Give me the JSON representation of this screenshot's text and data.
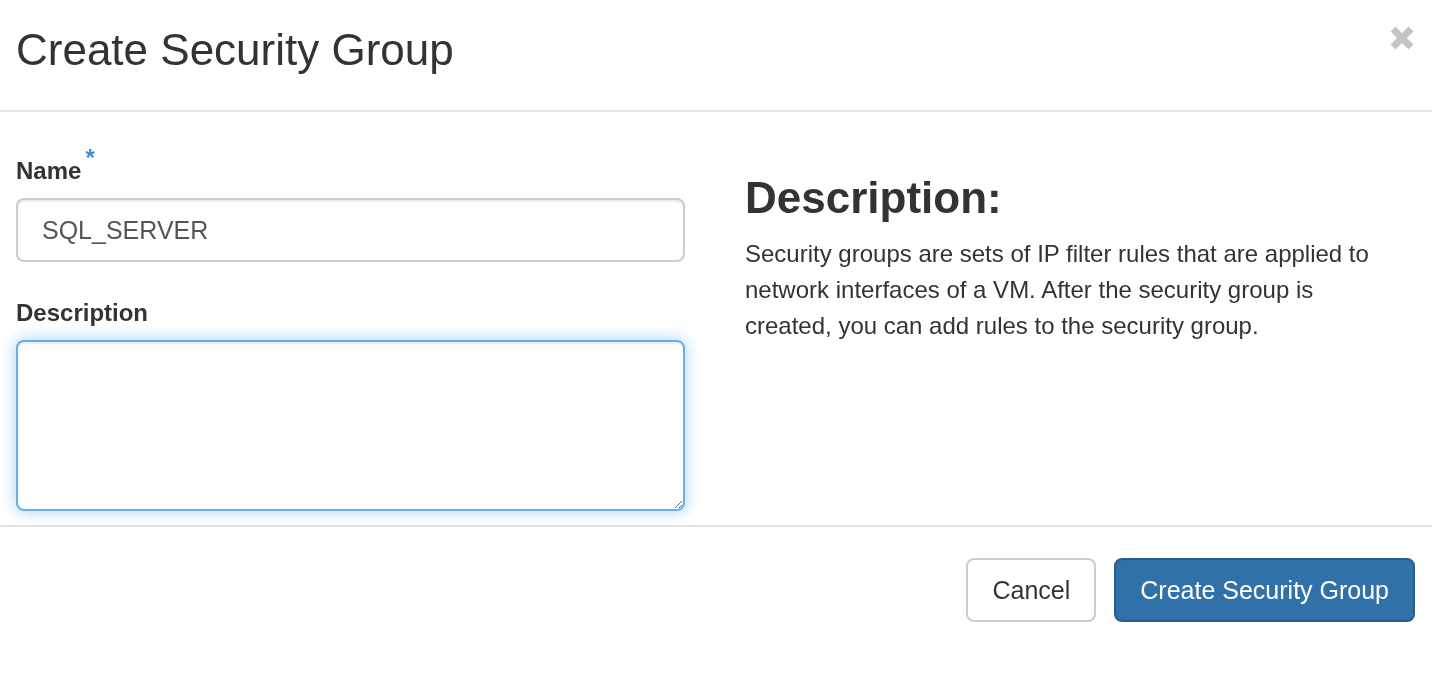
{
  "dialog": {
    "title": "Create Security Group"
  },
  "fields": [
    {
      "kind": "input",
      "label": "Name",
      "required_mark": "*",
      "value": "SQL_SERVER",
      "focused": false
    },
    {
      "kind": "textarea",
      "label": "Description",
      "focused": true
    }
  ],
  "help": {
    "heading": "Description:",
    "text": "Security groups are sets of IP filter rules that are applied to network interfaces of a VM. After the security group is created, you can add rules to the security group."
  },
  "buttons": [
    {
      "label": "Cancel",
      "kind": "default"
    },
    {
      "label": "Create Security Group",
      "kind": "primary"
    }
  ]
}
